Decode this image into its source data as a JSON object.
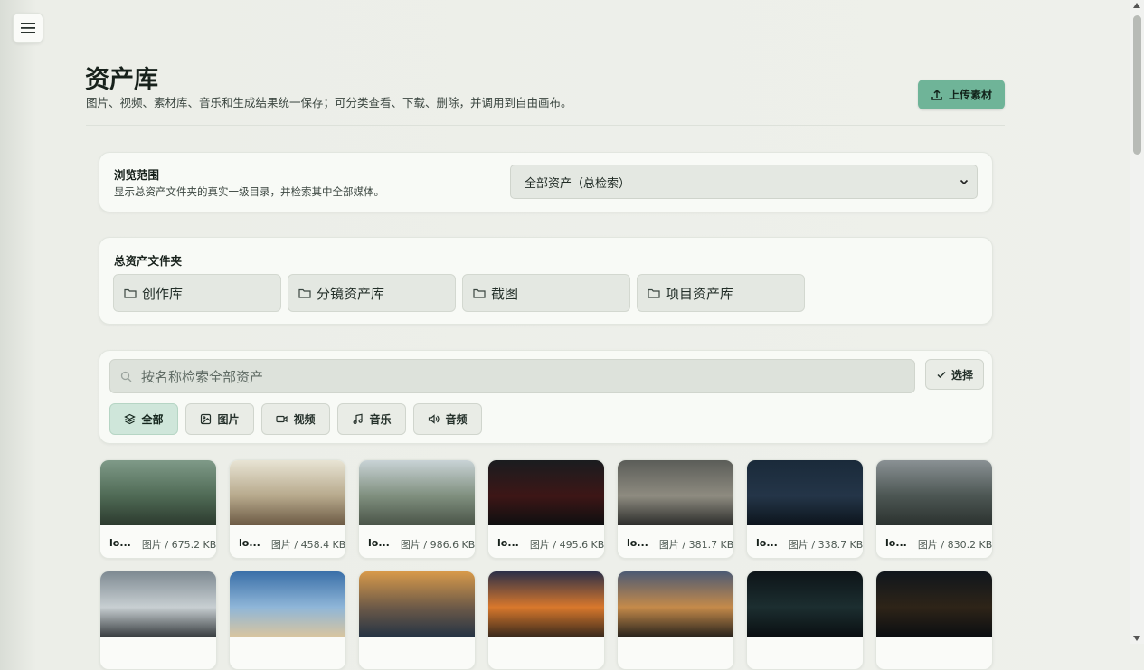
{
  "header": {
    "title": "资产库",
    "subtitle": "图片、视频、素材库、音乐和生成结果统一保存；可分类查看、下载、删除，并调用到自由画布。",
    "upload_label": "上传素材"
  },
  "scope": {
    "title": "浏览范围",
    "description": "显示总资产文件夹的真实一级目录，并检索其中全部媒体。",
    "selected": "全部资产（总检索）"
  },
  "folders": {
    "title": "总资产文件夹",
    "items": [
      {
        "label": "创作库"
      },
      {
        "label": "分镜资产库"
      },
      {
        "label": "截图"
      },
      {
        "label": "项目资产库"
      }
    ]
  },
  "search": {
    "placeholder": "按名称检索全部资产",
    "select_label": "选择"
  },
  "filters": [
    {
      "label": "全部",
      "icon": "layers-icon",
      "active": true
    },
    {
      "label": "图片",
      "icon": "image-icon",
      "active": false
    },
    {
      "label": "视频",
      "icon": "video-icon",
      "active": false
    },
    {
      "label": "音乐",
      "icon": "music-note-icon",
      "active": false
    },
    {
      "label": "音频",
      "icon": "speaker-icon",
      "active": false
    }
  ],
  "assets": [
    {
      "name": "lo...",
      "meta": "图片 / 675.2 KB",
      "colors": [
        "#7f9a88",
        "#4f6a55",
        "#2c3a2e"
      ]
    },
    {
      "name": "lo...",
      "meta": "图片 / 458.4 KB",
      "colors": [
        "#e8e4d4",
        "#b7a98c",
        "#6c5a44"
      ]
    },
    {
      "name": "lo...",
      "meta": "图片 / 986.6 KB",
      "colors": [
        "#c9d3d6",
        "#7f8f7e",
        "#4a5448"
      ]
    },
    {
      "name": "lo...",
      "meta": "图片 / 495.6 KB",
      "colors": [
        "#1a1c1f",
        "#3d1616",
        "#0e0f10"
      ]
    },
    {
      "name": "lo...",
      "meta": "图片 / 381.7 KB",
      "colors": [
        "#5b5d58",
        "#8e8b80",
        "#2c2d2b"
      ]
    },
    {
      "name": "lo...",
      "meta": "图片 / 338.7 KB",
      "colors": [
        "#1a2a3a",
        "#243548",
        "#0c141c"
      ]
    },
    {
      "name": "lo...",
      "meta": "图片 / 830.2 KB",
      "colors": [
        "#8a9194",
        "#4c5653",
        "#2b322f"
      ]
    }
  ],
  "assets_row2": [
    {
      "colors": [
        "#7e8a92",
        "#c8cfd2",
        "#3a3f42"
      ]
    },
    {
      "colors": [
        "#3a6fa8",
        "#8fb6d8",
        "#d8c5a0"
      ]
    },
    {
      "colors": [
        "#d89a4a",
        "#6d5a48",
        "#263444"
      ]
    },
    {
      "colors": [
        "#2b2f48",
        "#d9782c",
        "#3b2a1c"
      ]
    },
    {
      "colors": [
        "#4c5a74",
        "#c58a4a",
        "#2a241d"
      ]
    },
    {
      "colors": [
        "#0d1418",
        "#1c2e30",
        "#0a0f12"
      ]
    },
    {
      "colors": [
        "#10161c",
        "#2e2418",
        "#0b0e11"
      ]
    }
  ]
}
